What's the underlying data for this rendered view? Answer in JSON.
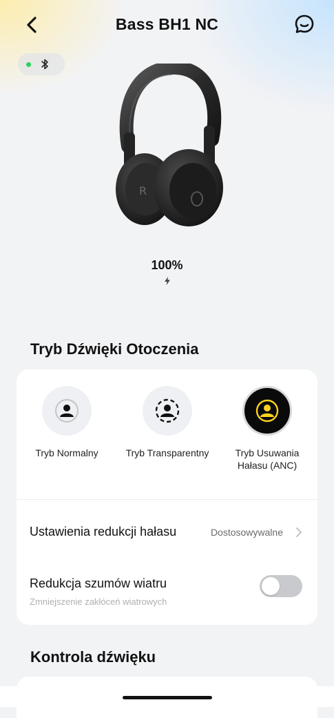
{
  "header": {
    "title": "Bass BH1 NC",
    "back_icon": "chevron-left-icon",
    "support_icon": "chat-bubble-icon"
  },
  "connection": {
    "status_color": "#2fd35b",
    "icon": "bluetooth-icon"
  },
  "device": {
    "image": "over-ear-headphones",
    "battery_percent": "100%",
    "charging_icon": "lightning-bolt-icon"
  },
  "ambient": {
    "section_title": "Tryb Dźwięki Otoczenia",
    "modes": [
      {
        "label": "Tryb Normalny",
        "icon": "person-normal-icon",
        "active": false
      },
      {
        "label": "Tryb Transparentny",
        "icon": "person-transparent-icon",
        "active": false
      },
      {
        "label": "Tryb Usuwania Hałasu (ANC)",
        "icon": "person-anc-icon",
        "active": true
      }
    ],
    "accent_color": "#ffd21f",
    "noise_reduction": {
      "label": "Ustawienia redukcji hałasu",
      "value": "Dostosowywalne"
    },
    "wind": {
      "label": "Redukcja szumów wiatru",
      "sublabel": "Zmniejszenie zakłóceń wiatrowych",
      "enabled": false
    }
  },
  "sound_control": {
    "section_title": "Kontrola dźwięku"
  }
}
